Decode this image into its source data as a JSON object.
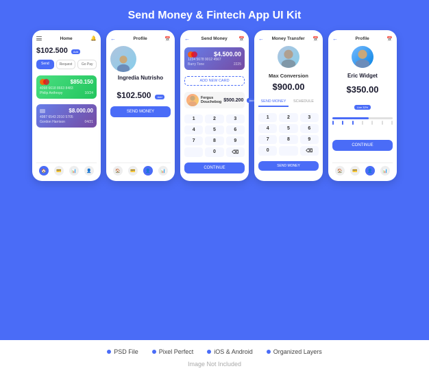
{
  "page": {
    "title": "Send Money & Fintech App UI Kit"
  },
  "features": [
    "PSD File",
    "Pixel Perfect",
    "iOS & Android",
    "Organized Layers"
  ],
  "image_note": "Image Not Included",
  "phones": [
    {
      "id": "home",
      "header_label": "Home",
      "balance": "$102.500",
      "badge": "Add",
      "actions": [
        "Send",
        "Request",
        "Go Pay"
      ],
      "cards": [
        {
          "amount": "$850.150",
          "number": "4098 6618 8663 8483",
          "name": "Philip Anthropy",
          "expiry": "10/24"
        },
        {
          "amount": "$8.000.00",
          "number": "4987 6543 2010 5705",
          "name": "Gordon Harrison",
          "expiry": "04/21"
        }
      ]
    },
    {
      "id": "profile",
      "header_label": "Profile",
      "name": "Ingredia Nutrisho",
      "balance": "$102.500",
      "badge": "Add",
      "btn_label": "SEND MONEY"
    },
    {
      "id": "send-money",
      "header_label": "Send Money",
      "card_number": "1234 5678 9012 4567",
      "card_name": "Barry Tone",
      "card_expiry": "2225",
      "card_amount": "$4.500.00",
      "add_card_label": "ADD NEW CARD",
      "recipient_name": "Fergus Douchebog",
      "recipient_amount": "$500.200",
      "recipient_badge": "Add",
      "keypad": [
        "1",
        "2",
        "3",
        "4",
        "5",
        "6",
        "7",
        "8",
        "9",
        "",
        "0",
        "⌫"
      ],
      "btn_label": "CONTINUE"
    },
    {
      "id": "money-transfer",
      "header_label": "Money Transfer",
      "name": "Max Conversion",
      "amount": "$900.00",
      "tabs": [
        "SEND MONEY",
        "SCHEDULE"
      ],
      "keypad": [
        "1",
        "2",
        "3",
        "4",
        "5",
        "6",
        "7",
        "8",
        "9",
        "0",
        "",
        "⌫"
      ],
      "btn_label": "SEND MONEY"
    },
    {
      "id": "profile2",
      "header_label": "Profile",
      "name": "Eric Widget",
      "balance": "$350.00",
      "badge_label": "Live 32%",
      "btn_label": "CONTINUE"
    }
  ]
}
